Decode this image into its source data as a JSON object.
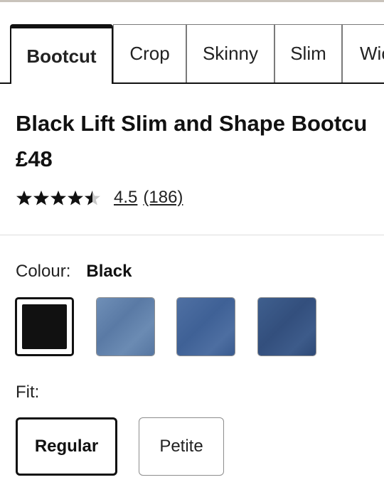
{
  "tabs": [
    {
      "label": "Bootcut",
      "active": true
    },
    {
      "label": "Crop",
      "active": false
    },
    {
      "label": "Skinny",
      "active": false
    },
    {
      "label": "Slim",
      "active": false
    },
    {
      "label": "Wic",
      "active": false
    }
  ],
  "product": {
    "title": "Black Lift Slim and Shape Bootcu",
    "price": "£48",
    "rating": {
      "stars_value": 4.5,
      "stars_max": 5,
      "score_text": "4.5",
      "count_text": "(186)"
    }
  },
  "colour": {
    "label": "Colour:",
    "selected_value": "Black",
    "swatches": [
      {
        "name": "black",
        "color": "#111111",
        "selected": true
      },
      {
        "name": "light-denim",
        "color": "#6282ad",
        "selected": false
      },
      {
        "name": "mid-denim",
        "color": "#4667a0",
        "selected": false
      },
      {
        "name": "dark-denim",
        "color": "#385686",
        "selected": false
      }
    ]
  },
  "fit": {
    "label": "Fit:",
    "options": [
      {
        "label": "Regular",
        "selected": true
      },
      {
        "label": "Petite",
        "selected": false
      }
    ]
  },
  "icons": {
    "star": "star-icon",
    "half_star": "half-star-icon"
  }
}
